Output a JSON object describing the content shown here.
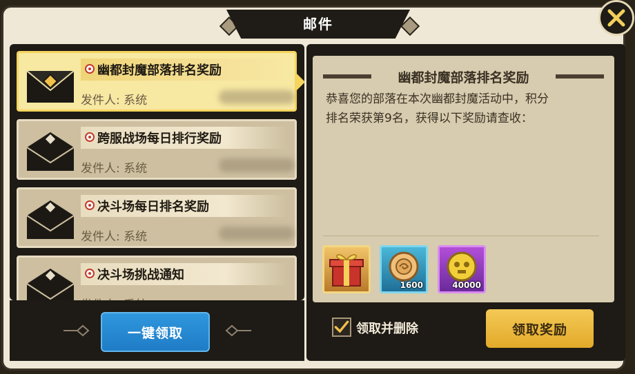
{
  "window": {
    "title": "邮件"
  },
  "mail_list": [
    {
      "subject": "幽都封魔部落排名奖励",
      "sender": "发件人: 系统",
      "selected": true
    },
    {
      "subject": "跨服战场每日排行奖励",
      "sender": "发件人: 系统",
      "selected": false
    },
    {
      "subject": "决斗场每日排名奖励",
      "sender": "发件人: 系统",
      "selected": false
    },
    {
      "subject": "决斗场挑战通知",
      "sender": "发件人: 系统",
      "selected": false
    }
  ],
  "actions": {
    "claim_all_label": "一键领取",
    "claim_label": "领取奖励",
    "delete_after_claim_label": "领取并删除",
    "delete_after_claim_checked": true
  },
  "detail": {
    "title": "幽都封魔部落排名奖励",
    "body_line1": "恭喜您的部落在本次幽都封魔活动中，积分",
    "body_line2": "排名荣获第9名，获得以下奖励请查收：",
    "rewards": [
      {
        "icon": "gift-box-icon",
        "qty": ""
      },
      {
        "icon": "blue-coin-icon",
        "qty": "1600"
      },
      {
        "icon": "gold-skull-coin-icon",
        "qty": "40000"
      }
    ]
  },
  "colors": {
    "selected_bg": "#f7e8a2",
    "claim_all": "#1f7cc6",
    "claim": "#e3aa2a"
  }
}
